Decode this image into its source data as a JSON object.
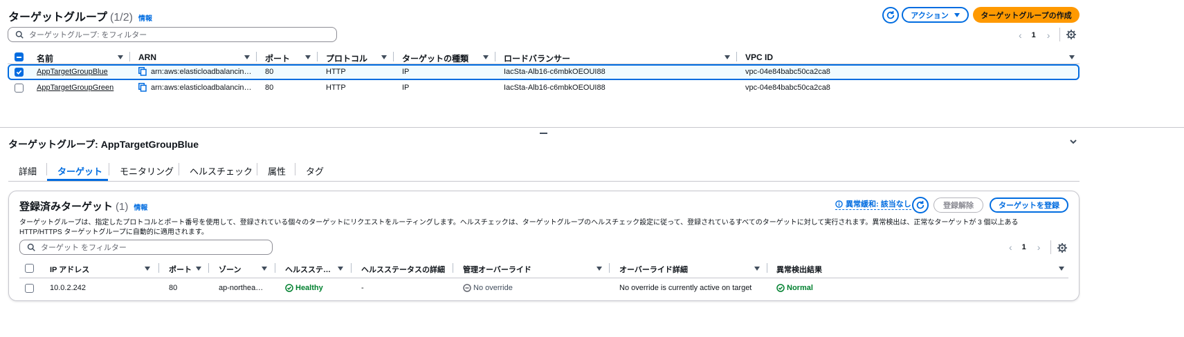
{
  "top": {
    "title": "ターゲットグループ",
    "count": "(1/2)",
    "info": "情報",
    "action_label": "アクション",
    "create_label": "ターゲットグループの作成",
    "filter_placeholder": "ターゲットグループ: をフィルター",
    "page": "1",
    "columns": [
      "名前",
      "ARN",
      "ポート",
      "プロトコル",
      "ターゲットの種類",
      "ロードバランサー",
      "VPC ID"
    ],
    "rows": [
      {
        "name": "AppTargetGroupBlue",
        "arn": "arn:aws:elasticloadbalancin…",
        "port": "80",
        "protocol": "HTTP",
        "type": "IP",
        "lb": "IacSta-Alb16-c6mbkOEOUI88",
        "vpc": "vpc-04e84babc50ca2ca8",
        "selected": true
      },
      {
        "name": "AppTargetGroupGreen",
        "arn": "arn:aws:elasticloadbalancin…",
        "port": "80",
        "protocol": "HTTP",
        "type": "IP",
        "lb": "IacSta-Alb16-c6mbkOEOUI88",
        "vpc": "vpc-04e84babc50ca2ca8",
        "selected": false
      }
    ]
  },
  "detail": {
    "title": "ターゲットグループ: AppTargetGroupBlue",
    "tabs": [
      "詳細",
      "ターゲット",
      "モニタリング",
      "ヘルスチェック",
      "属性",
      "タグ"
    ],
    "active_tab": "ターゲット"
  },
  "registered": {
    "title": "登録済みターゲット",
    "count": "(1)",
    "info": "情報",
    "anomaly_label": "異常緩和: 該当なし",
    "deregister_label": "登録解除",
    "register_label": "ターゲットを登録",
    "description_line1": "ターゲットグループは、指定したプロトコルとポート番号を使用して、登録されている個々のターゲットにリクエストをルーティングします。ヘルスチェックは、ターゲットグループのヘルスチェック設定に従って、登録されているすべてのターゲットに対して実行されます。異常検出は、正常なターゲットが 3 個以上ある",
    "description_line2": "HTTP/HTTPS ターゲットグループに自動的に適用されます。",
    "filter_placeholder": "ターゲット をフィルター",
    "page": "1",
    "columns": [
      "IP アドレス",
      "ポート",
      "ゾーン",
      "ヘルスステ…",
      "ヘルスステータスの詳細",
      "管理オーバーライド",
      "オーバーライド詳細",
      "異常検出結果"
    ],
    "rows": [
      {
        "ip": "10.0.2.242",
        "port": "80",
        "zone": "ap-northea…",
        "health": "Healthy",
        "health_detail": "-",
        "override": "No override",
        "override_detail": "No override is currently active on target",
        "anomaly": "Normal"
      }
    ]
  },
  "colors": {
    "accent": "#006ce0",
    "primary_button": "#ff9900",
    "selected_row": "#f0fbff",
    "healthy": "#00802f"
  }
}
